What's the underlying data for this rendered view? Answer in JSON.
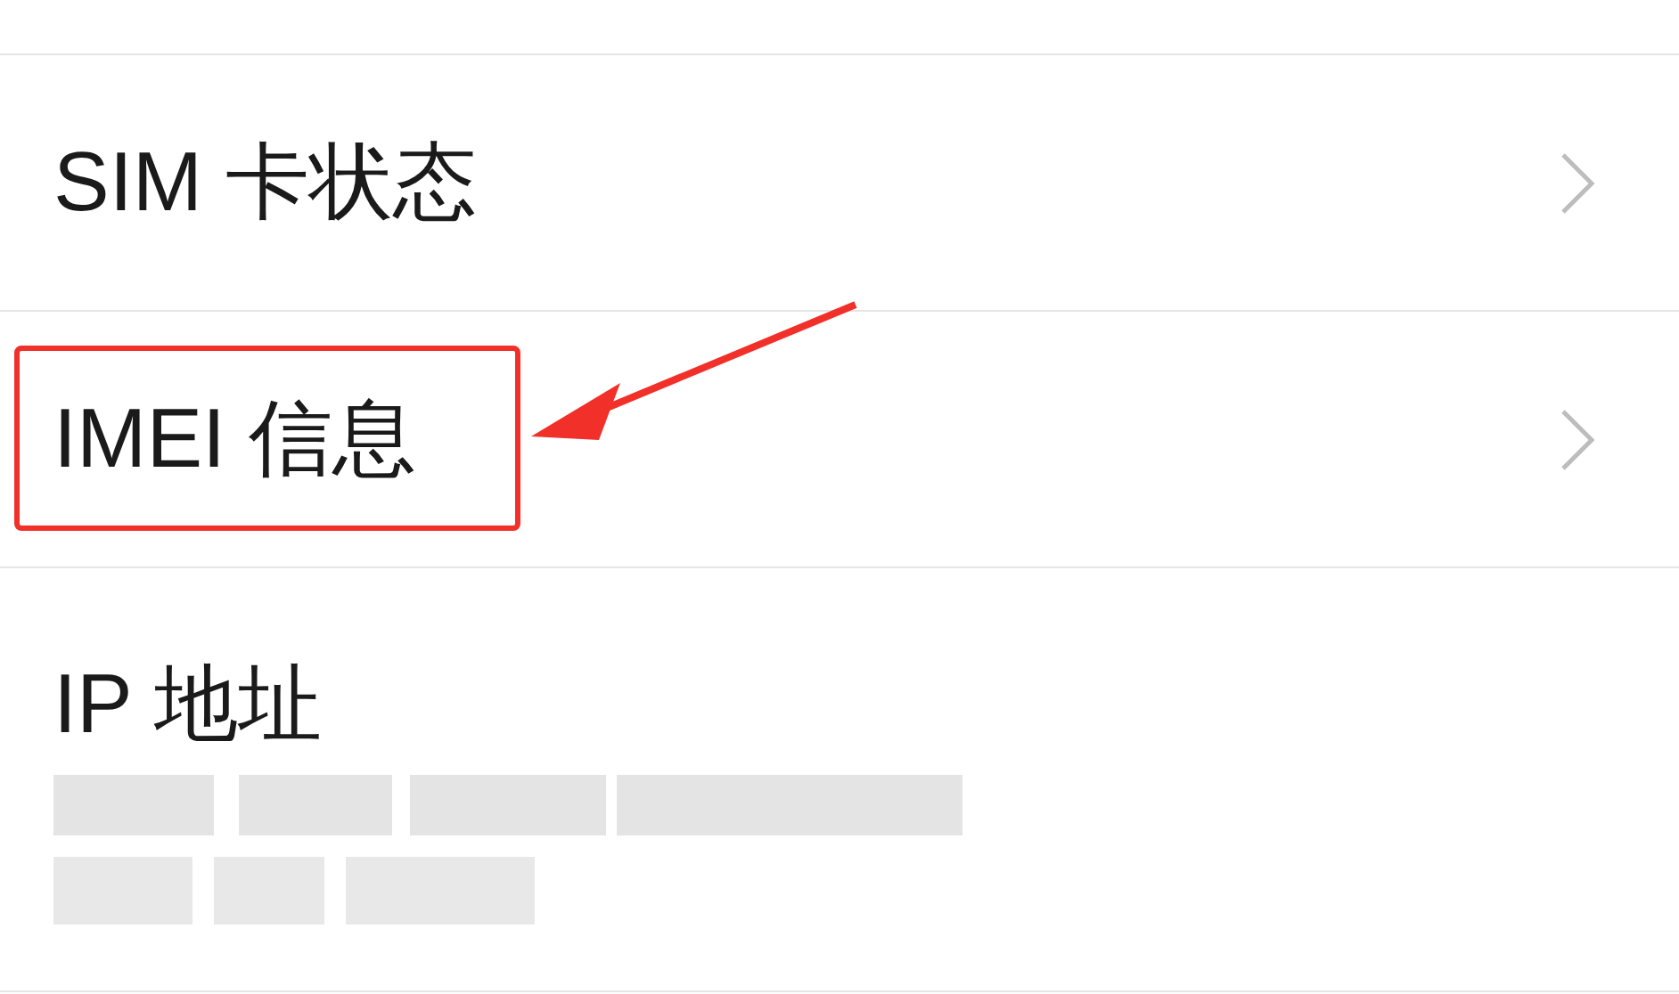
{
  "rows": [
    {
      "label": "SIM 卡状态",
      "kind": "link"
    },
    {
      "label": "IMEI 信息",
      "kind": "link",
      "highlighted": true
    },
    {
      "label": "IP 地址",
      "kind": "info",
      "redacted": true
    }
  ]
}
